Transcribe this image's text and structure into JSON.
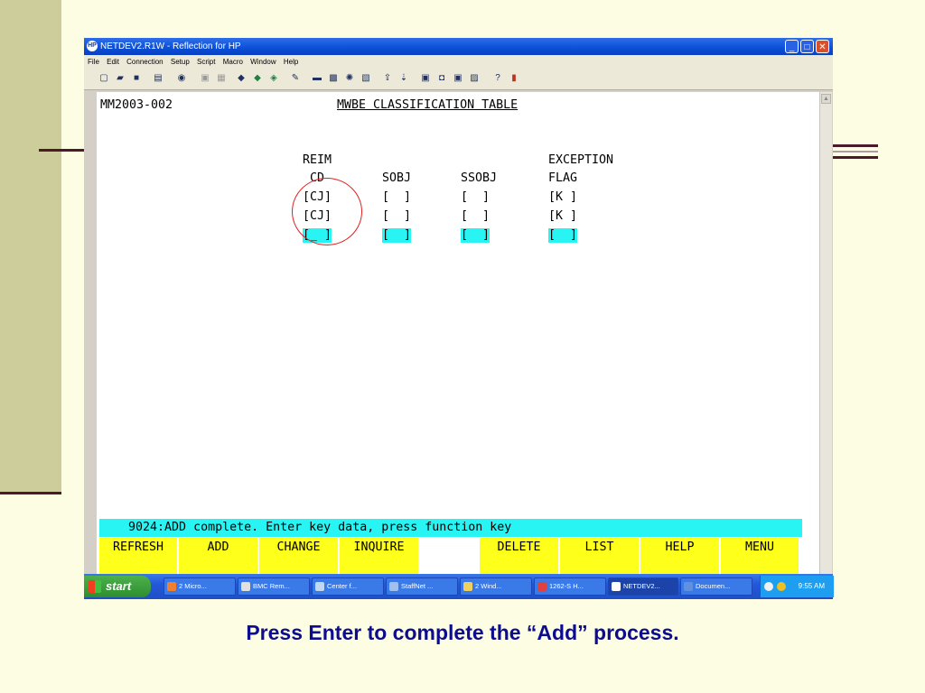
{
  "window": {
    "title": "NETDEV2.R1W - Reflection for HP",
    "app_icon": "HP",
    "controls": [
      "minimize-icon",
      "maximize-icon",
      "close-icon"
    ]
  },
  "menubar": [
    "File",
    "Edit",
    "Connection",
    "Setup",
    "Script",
    "Macro",
    "Window",
    "Help"
  ],
  "toolbar_icons": [
    "new-icon",
    "open-icon",
    "save-icon",
    "print-icon",
    "find-icon",
    "copy-icon",
    "paste-icon",
    "connect-icon",
    "disconnect-icon",
    "transfer-icon",
    "macro-icon",
    "keyboard-icon",
    "display-icon",
    "settings-icon",
    "color-icon",
    "upload-icon",
    "download-icon",
    "screen1-icon",
    "screen2-icon",
    "screen3-icon",
    "screen4-icon",
    "help-icon",
    "book-icon"
  ],
  "terminal": {
    "screen_id": "MM2003-002",
    "screen_title": "MWBE CLASSIFICATION TABLE",
    "headers": {
      "reim_line1": "REIM",
      "reim_line2": "CD",
      "sobj": "SOBJ",
      "ssobj": "SSOBJ",
      "exception_line1": "EXCEPTION",
      "exception_line2": "FLAG"
    },
    "rows": [
      {
        "reim": "[CJ]",
        "sobj": "[  ]",
        "ssobj": "[  ]",
        "flag": "[K ]"
      },
      {
        "reim": "[CJ]",
        "sobj": "[  ]",
        "ssobj": "[  ]",
        "flag": "[K ]"
      }
    ],
    "input_row": {
      "reim": "[_ ]",
      "sobj": "[  ]",
      "ssobj": "[  ]",
      "flag": "[  ]"
    },
    "status_message": "    9024:ADD complete. Enter key data, press function key",
    "function_keys": [
      "REFRESH",
      "ADD",
      "CHANGE",
      "INQUIRE",
      "",
      "DELETE",
      "LIST",
      "HELP",
      "MENU"
    ]
  },
  "taskbar": {
    "start_label": "start",
    "tasks": [
      "2 Micro...",
      "BMC Rem...",
      "Center f...",
      "StaffNet ...",
      "2 Wind...",
      "1262-S H...",
      "NETDEV2...",
      "Documen..."
    ],
    "clock": "9:55 AM"
  },
  "caption": "Press Enter to complete the “Add” process.",
  "colors": {
    "highlight_field": "#29f4f4",
    "function_key": "#ffff1c",
    "annotation_circle": "#e02020",
    "caption": "#0c0c90"
  }
}
